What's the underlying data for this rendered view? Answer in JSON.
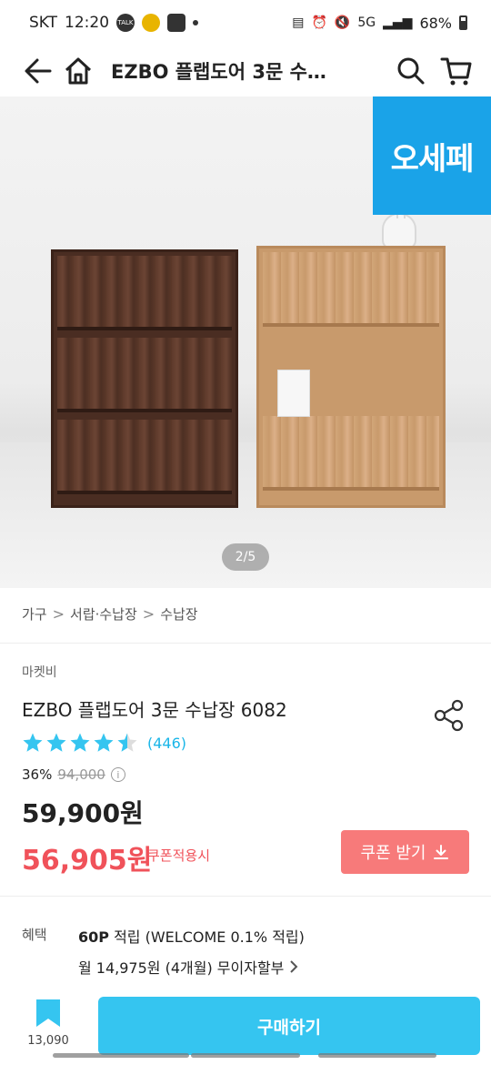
{
  "status_bar": {
    "carrier": "SKT",
    "time": "12:20",
    "network": "5G",
    "battery": "68%"
  },
  "app_bar": {
    "title": "EZBO 플랩도어 3문 수납장 6082"
  },
  "hero": {
    "badge_text": "오세페",
    "pager": "2/5"
  },
  "breadcrumb": [
    "가구",
    "서랍·수납장",
    "수납장"
  ],
  "product": {
    "seller": "마켓비",
    "title": "EZBO 플랩도어 3문 수납장 6082",
    "rating": 4.5,
    "review_count": "(446)",
    "discount_rate": "36%",
    "original_price": "94,000",
    "price": "59,900원",
    "coupon_price": "56,905원",
    "coupon_note": "쿠폰적용시",
    "coupon_button": "쿠폰 받기"
  },
  "benefits": {
    "label": "혜택",
    "points_bold": "60P",
    "points_text": " 적립 (WELCOME 0.1% 적립)",
    "installment": "월 14,975원 (4개월) 무이자할부"
  },
  "bottom": {
    "bookmark_count": "13,090",
    "buy_label": "구매하기"
  },
  "colors": {
    "accent": "#35c5f0",
    "sale": "#f0525a",
    "badge": "#1aa3e8",
    "star": "#35c5f0"
  }
}
